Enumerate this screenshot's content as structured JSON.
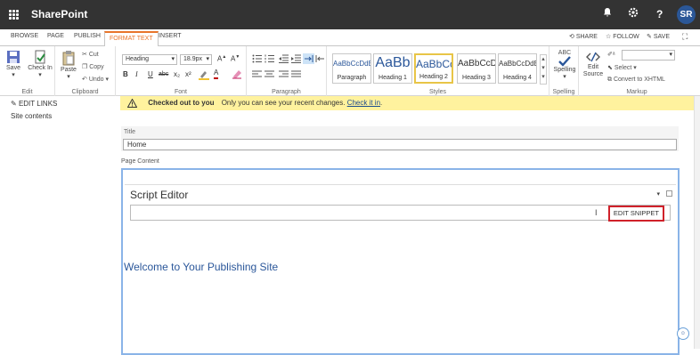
{
  "suite_bar": {
    "app_name": "SharePoint",
    "avatar_initials": "SR",
    "help_label": "?"
  },
  "ribbon_tabs": [
    "BROWSE",
    "PAGE",
    "PUBLISH",
    "FORMAT TEXT",
    "INSERT"
  ],
  "active_tab": "FORMAT TEXT",
  "page_actions": {
    "share": "SHARE",
    "follow": "FOLLOW",
    "save": "SAVE"
  },
  "ribbon": {
    "edit": {
      "save": "Save",
      "check_in": "Check In",
      "label": "Edit"
    },
    "clipboard": {
      "paste": "Paste",
      "cut": "Cut",
      "copy": "Copy",
      "undo": "Undo",
      "label": "Clipboard"
    },
    "font": {
      "style_value": "Heading",
      "size_value": "18.9px",
      "label": "Font",
      "bold": "B",
      "italic": "I",
      "underline": "U",
      "strike": "abc",
      "sub": "x₂",
      "sup": "x²",
      "font_color": "A"
    },
    "paragraph": {
      "label": "Paragraph"
    },
    "styles": {
      "label": "Styles",
      "items": [
        {
          "preview": "AaBbCcDdE",
          "name": "Paragraph"
        },
        {
          "preview": "AaBb",
          "name": "Heading 1"
        },
        {
          "preview": "AaBbCc",
          "name": "Heading 2"
        },
        {
          "preview": "AaBbCcDc",
          "name": "Heading 3"
        },
        {
          "preview": "AaBbCcDdE",
          "name": "Heading 4"
        }
      ]
    },
    "spelling": {
      "abc": "ABC",
      "button": "Spelling",
      "label": "Spelling"
    },
    "markup": {
      "edit_source": "Edit Source",
      "select": "Select",
      "convert": "Convert to XHTML",
      "label": "Markup"
    }
  },
  "left_nav": {
    "edit_links": "EDIT LINKS",
    "site_contents": "Site contents"
  },
  "status_banner": {
    "title": "Checked out to you",
    "message": "Only you can see your recent changes.",
    "link": "Check it in",
    "period": "."
  },
  "title_field": {
    "label": "Title",
    "value": "Home"
  },
  "page_content_label": "Page Content",
  "script_editor": {
    "title": "Script Editor",
    "edit_snippet": "EDIT SNIPPET"
  },
  "welcome_text": "Welcome to Your Publishing Site",
  "colors": {
    "topbar": "#333333",
    "accent_tab": "#e8752b",
    "banner": "#fff29e",
    "link": "#2b579a",
    "highlight": "#d0212a"
  }
}
